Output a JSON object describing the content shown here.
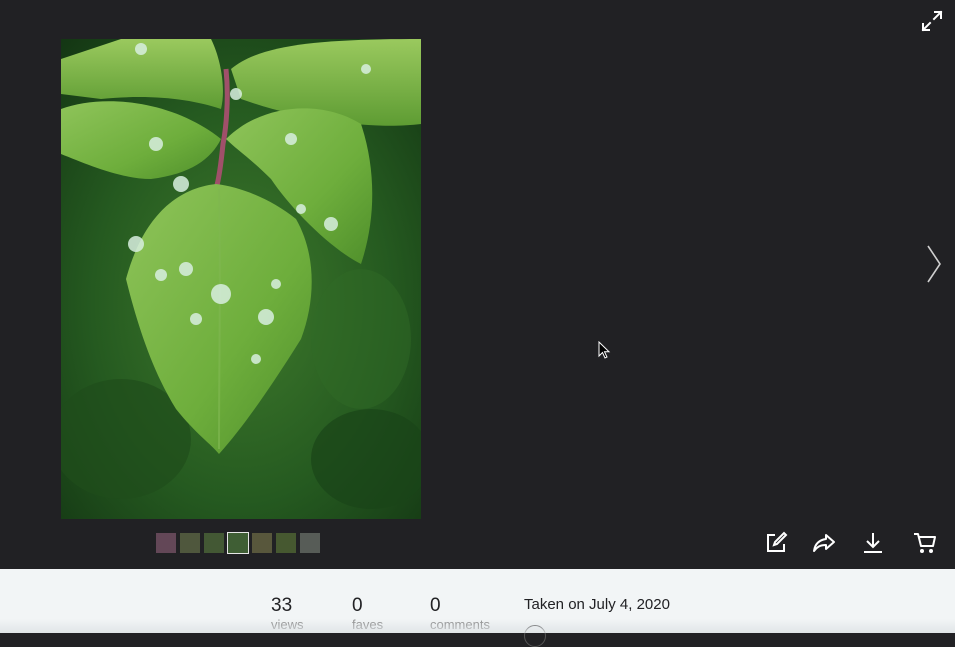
{
  "icons": {
    "expand": "expand-icon",
    "next": "chevron-right-icon",
    "edit": "edit-icon",
    "share": "share-icon",
    "download": "download-icon",
    "cart": "cart-icon",
    "cursor": "mouse-pointer-icon"
  },
  "thumbnails": [
    {
      "color": "#7a5468"
    },
    {
      "color": "#5f6a45"
    },
    {
      "color": "#4f6b3a"
    },
    {
      "color": "#3f5e34"
    },
    {
      "color": "#6b6a44"
    },
    {
      "color": "#536b34"
    },
    {
      "color": "#6a7068"
    }
  ],
  "stats": {
    "views": {
      "value": "33",
      "label": "views"
    },
    "faves": {
      "value": "0",
      "label": "faves"
    },
    "comments": {
      "value": "0",
      "label": "comments"
    }
  },
  "taken": "Taken on July 4, 2020",
  "colors": {
    "viewer_bg": "#212124",
    "info_bg": "#f2f5f6",
    "icon": "#ffffff"
  }
}
